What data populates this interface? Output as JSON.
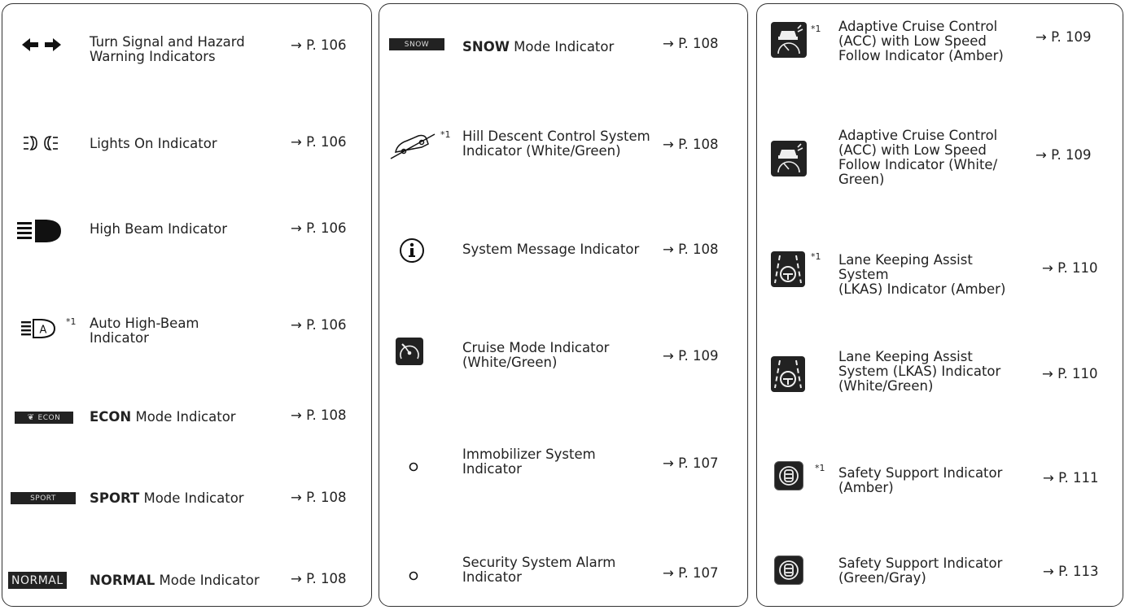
{
  "footnote_mark": "*1",
  "arrow": "→",
  "colors": {
    "border": "#333333",
    "badge_bg": "#222222",
    "text": "#222222"
  },
  "left_column": [
    {
      "id": "turn-signal",
      "icon": "turn-signal-arrows-icon",
      "label_lines": [
        "Turn Signal and Hazard",
        "Warning Indicators"
      ],
      "ref": "P. 106"
    },
    {
      "id": "lights-on",
      "icon": "lights-on-icon",
      "label": "Lights On Indicator",
      "ref": "P. 106"
    },
    {
      "id": "high-beam",
      "icon": "high-beam-icon",
      "label": "High Beam Indicator",
      "ref": "P. 106"
    },
    {
      "id": "auto-high-beam",
      "icon": "auto-high-beam-icon",
      "footnote": "*1",
      "label_lines": [
        "Auto High-Beam",
        "Indicator"
      ],
      "ref": "P. 106"
    },
    {
      "id": "econ",
      "icon": "econ-badge-icon",
      "badge": "ECON",
      "bold": "ECON",
      "rest": " Mode Indicator",
      "ref": "P. 108"
    },
    {
      "id": "sport",
      "icon": "sport-badge-icon",
      "badge": "SPORT",
      "bold": "SPORT",
      "rest": " Mode Indicator",
      "ref": "P. 108"
    },
    {
      "id": "normal",
      "icon": "normal-badge-icon",
      "badge": "NORMAL",
      "bold": "NORMAL",
      "rest": " Mode Indicator",
      "ref": "P. 108"
    }
  ],
  "middle_column": [
    {
      "id": "snow",
      "icon": "snow-badge-icon",
      "badge": "SNOW",
      "bold": "SNOW",
      "rest": " Mode Indicator",
      "ref": "P. 108"
    },
    {
      "id": "hill-descent",
      "icon": "hill-descent-icon",
      "footnote": "*1",
      "label_lines": [
        "Hill Descent Control System",
        "Indicator (White/Green)"
      ],
      "ref": "P. 108"
    },
    {
      "id": "system-message",
      "icon": "info-circle-icon",
      "label": "System Message Indicator",
      "ref": "P. 108"
    },
    {
      "id": "cruise-mode",
      "icon": "cruise-mode-icon",
      "label_lines": [
        "Cruise Mode Indicator",
        "(White/Green)"
      ],
      "ref": "P. 109"
    },
    {
      "id": "immobilizer",
      "icon": "immobilizer-icon",
      "label_lines": [
        "Immobilizer System",
        "Indicator"
      ],
      "ref": "P. 107"
    },
    {
      "id": "security-alarm",
      "icon": "security-alarm-icon",
      "label_lines": [
        "Security System Alarm",
        "Indicator"
      ],
      "ref": "P. 107"
    }
  ],
  "right_column": [
    {
      "id": "acc-amber",
      "icon": "acc-low-speed-follow-icon",
      "footnote": "*1",
      "label_lines": [
        "Adaptive Cruise Control",
        "(ACC) with Low Speed",
        "Follow Indicator (Amber)"
      ],
      "ref": "P. 109"
    },
    {
      "id": "acc-white-green",
      "icon": "acc-low-speed-follow-icon",
      "label_lines": [
        "Adaptive Cruise Control",
        "(ACC) with Low Speed",
        "Follow Indicator (White/",
        "Green)"
      ],
      "ref": "P. 109"
    },
    {
      "id": "lkas-amber",
      "icon": "lkas-icon",
      "footnote": "*1",
      "label_lines": [
        "Lane Keeping Assist System",
        "(LKAS) Indicator (Amber)"
      ],
      "ref": "P. 110"
    },
    {
      "id": "lkas-white-green",
      "icon": "lkas-icon",
      "label_lines": [
        "Lane Keeping Assist",
        "System (LKAS) Indicator",
        "(White/Green)"
      ],
      "ref": "P. 110"
    },
    {
      "id": "safety-amber",
      "icon": "safety-support-icon",
      "footnote": "*1",
      "label_lines": [
        "Safety Support Indicator",
        "(Amber)"
      ],
      "ref": "P. 111"
    },
    {
      "id": "safety-green-gray",
      "icon": "safety-support-icon",
      "label_lines": [
        "Safety Support Indicator",
        "(Green/Gray)"
      ],
      "ref": "P. 113"
    }
  ]
}
